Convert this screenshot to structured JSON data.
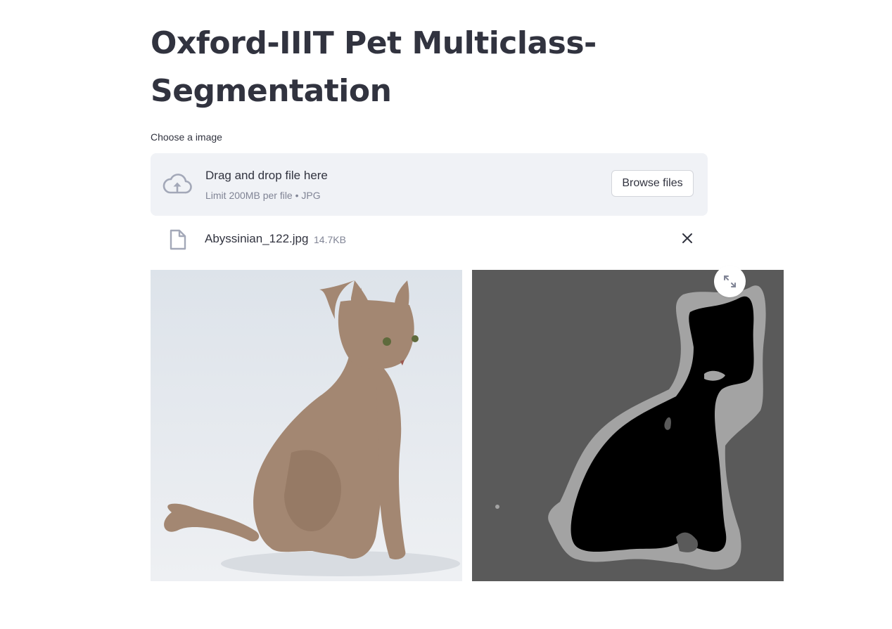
{
  "page": {
    "title": "Oxford-IIIT Pet Multiclass-Segmentation"
  },
  "uploader": {
    "label": "Choose a image",
    "instructions": "Drag and drop file here",
    "limit_text": "Limit 200MB per file • JPG",
    "browse_label": "Browse files",
    "icon": "cloud-upload-icon"
  },
  "uploaded_file": {
    "name": "Abyssinian_122.jpg",
    "size": "14.7KB",
    "icon": "file-icon",
    "remove_icon": "close-icon"
  },
  "images": {
    "original": {
      "subject": "cat-photo"
    },
    "mask": {
      "subject": "segmentation-mask",
      "fullscreen_icon": "expand-icon"
    }
  },
  "colors": {
    "text": "#31333f",
    "muted": "#808495",
    "dropzone_bg": "#f0f2f6",
    "mask_background": "#5a5a5a",
    "mask_border": "#a3a3a3",
    "mask_foreground": "#000000"
  }
}
